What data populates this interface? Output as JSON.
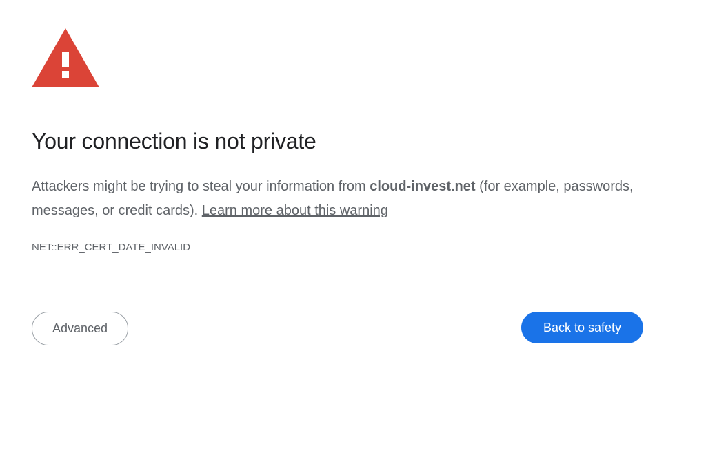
{
  "icon": "warning-triangle-icon",
  "colors": {
    "warning_red": "#db4437",
    "primary_blue": "#1a73e8",
    "text_dark": "#202124",
    "text_gray": "#5f6368"
  },
  "title": "Your connection is not private",
  "body": {
    "before_domain": "Attackers might be trying to steal your information from ",
    "domain": "cloud-invest.net",
    "after_domain": " (for example, passwords, messages, or credit cards). ",
    "learn_more": "Learn more about this warning"
  },
  "error_code": "NET::ERR_CERT_DATE_INVALID",
  "buttons": {
    "advanced": "Advanced",
    "back_to_safety": "Back to safety"
  }
}
